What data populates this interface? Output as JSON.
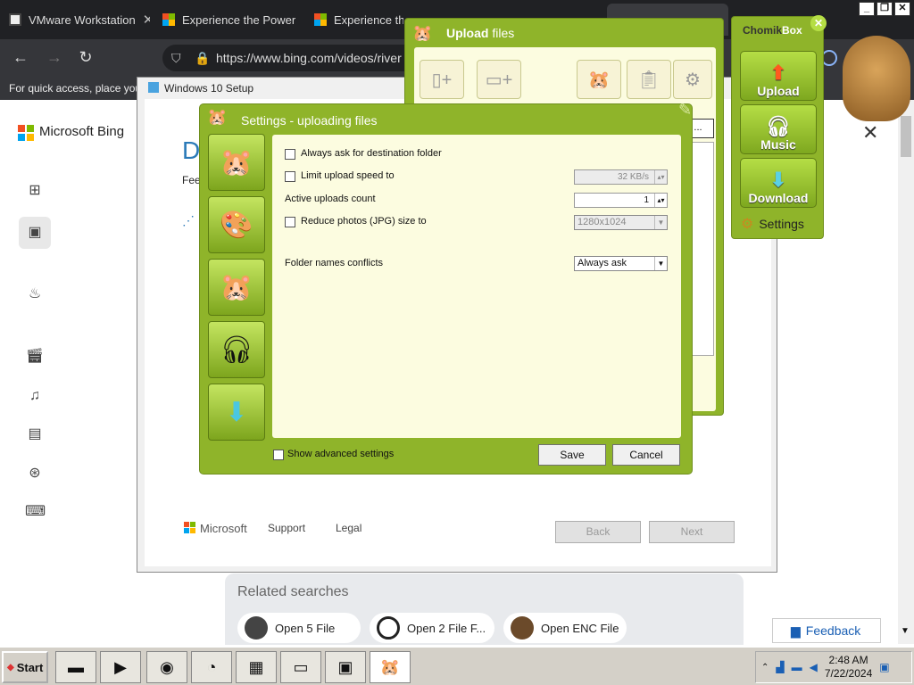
{
  "browser": {
    "tabs": [
      {
        "label": "VMware Workstation",
        "close": "✕"
      },
      {
        "label": "Experience the Power",
        "close": "✕"
      },
      {
        "label": "Experience the",
        "close": ""
      }
    ],
    "url": "https://www.bing.com/videos/river",
    "bookmarks_hint": "For quick access, place you"
  },
  "bing": {
    "logo_text": "Microsoft Bing",
    "close_glyph": "✕",
    "related_title": "Related searches",
    "related": [
      "Open 5 File",
      "Open 2 File F...",
      "Open ENC File"
    ],
    "feedback": "Feedback"
  },
  "setup": {
    "title": "Windows 10 Setup",
    "heading_char": "D",
    "feel_text": "Feel",
    "ms_logo_text": "Microsoft",
    "support": "Support",
    "legal": "Legal",
    "back": "Back",
    "next": "Next"
  },
  "upload": {
    "title_bold": "Upload",
    "title_rest": " files"
  },
  "chomikbox": {
    "title_a": "Chomik",
    "title_b": "Box",
    "upload": "Upload",
    "music": "Music",
    "download": "Download",
    "settings": "Settings"
  },
  "settings": {
    "title": "Settings - uploading files",
    "always_ask": "Always ask for destination folder",
    "limit_speed": "Limit upload speed to",
    "speed_value": "32 KB/s",
    "active_uploads": "Active uploads count",
    "active_value": "1",
    "reduce_photos": "Reduce photos (JPG) size to",
    "photo_size": "1280x1024",
    "folder_conflicts": "Folder names conflicts",
    "conflict_value": "Always ask",
    "show_advanced": "Show advanced settings",
    "save": "Save",
    "cancel": "Cancel"
  },
  "taskbar": {
    "start": "Start",
    "time": "2:48 AM",
    "date": "7/22/2024"
  },
  "icons": [
    "search-icon",
    "video-icon",
    "flame-icon",
    "film-icon",
    "music-icon",
    "news-icon",
    "sports-icon",
    "gamepad-icon"
  ]
}
